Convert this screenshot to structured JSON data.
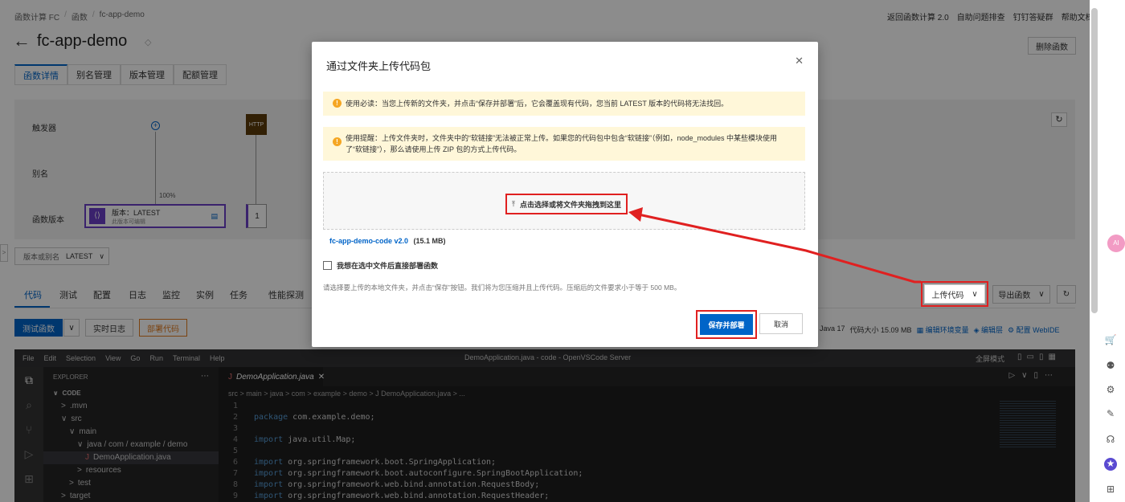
{
  "breadcrumb": {
    "items": [
      "函数计算 FC",
      "函数",
      "fc-app-demo"
    ]
  },
  "header_links": [
    "返回函数计算 2.0",
    "自助问题排查",
    "钉钉答疑群",
    "帮助文档"
  ],
  "page_title": "fc-app-demo",
  "delete_button": "删除函数",
  "main_tabs": [
    "函数详情",
    "别名管理",
    "版本管理",
    "配额管理"
  ],
  "flow": {
    "rows": [
      "触发器",
      "别名",
      "函数版本"
    ],
    "http_label": "HTTP",
    "percent": "100%",
    "version_title": "版本：LATEST",
    "version_sub": "此版本可编辑",
    "version_num": "1"
  },
  "version_select": {
    "label": "版本或别名",
    "value": "LATEST"
  },
  "sub_tabs": [
    "代码",
    "测试",
    "配置",
    "日志",
    "监控",
    "实例",
    "任务",
    "性能探测"
  ],
  "upload_code_button": "上传代码",
  "export_button": "导出函数",
  "test_button": "测试函数",
  "live_log_button": "实时日志",
  "deploy_button": "部署代码",
  "runtime_info": {
    "runtime": "Java 17",
    "size": "代码大小 15.09 MB",
    "env": "编辑环境变量",
    "layer": "编辑层",
    "webide": "配置 WebIDE"
  },
  "vscode": {
    "menu": [
      "File",
      "Edit",
      "Selection",
      "View",
      "Go",
      "Run",
      "Terminal",
      "Help"
    ],
    "title": "DemoApplication.java - code - OpenVSCode Server",
    "fullscreen": "全屏模式",
    "explorer_title": "EXPLORER",
    "tree": [
      {
        "label": "CODE",
        "indent": 0,
        "arrow": "∨"
      },
      {
        "label": ".mvn",
        "indent": 1,
        "arrow": ">"
      },
      {
        "label": "src",
        "indent": 1,
        "arrow": "∨"
      },
      {
        "label": "main",
        "indent": 2,
        "arrow": "∨"
      },
      {
        "label": "java / com / example / demo",
        "indent": 3,
        "arrow": "∨"
      },
      {
        "label": "DemoApplication.java",
        "indent": 4,
        "arrow": "J"
      },
      {
        "label": "resources",
        "indent": 3,
        "arrow": ">"
      },
      {
        "label": "test",
        "indent": 2,
        "arrow": ">"
      },
      {
        "label": "target",
        "indent": 1,
        "arrow": ">"
      }
    ],
    "tab_name": "DemoApplication.java",
    "path": "src > main > java > com > example > demo > J DemoApplication.java > ...",
    "code": [
      {
        "n": "1",
        "t": ""
      },
      {
        "n": "2",
        "t": "package com.example.demo;"
      },
      {
        "n": "3",
        "t": ""
      },
      {
        "n": "4",
        "t": "import java.util.Map;"
      },
      {
        "n": "5",
        "t": ""
      },
      {
        "n": "6",
        "t": "import org.springframework.boot.SpringApplication;"
      },
      {
        "n": "7",
        "t": "import org.springframework.boot.autoconfigure.SpringBootApplication;"
      },
      {
        "n": "8",
        "t": "import org.springframework.web.bind.annotation.RequestBody;"
      },
      {
        "n": "9",
        "t": "import org.springframework.web.bind.annotation.RequestHeader;"
      }
    ]
  },
  "modal": {
    "title": "通过文件夹上传代码包",
    "warning1": "使用必读：当您上传新的文件夹，并点击“保存并部署”后，它会覆盖现有代码，您当前 LATEST 版本的代码将无法找回。",
    "warning2": "使用提醒：上传文件夹时，文件夹中的“软链接”无法被正常上传。如果您的代码包中包含“软链接”（例如，node_modules 中某些模块使用了“软链接”），那么请使用上传 ZIP 包的方式上传代码。",
    "dropzone": "点击选择或将文件夹拖拽到这里",
    "file_name": "fc-app-demo-code v2.0",
    "file_size": "(15.1 MB)",
    "checkbox_label": "我想在选中文件后直接部署函数",
    "hint": "请选择要上传的本地文件夹，并点击“保存”按钮。我们将为您压缩并且上传代码。压缩后的文件要求小于等于 500 MB。",
    "save_button": "保存并部署",
    "cancel_button": "取消"
  },
  "colors": {
    "accent": "#0064c8",
    "highlight": "#e02020",
    "warn_bg": "#fff7d9",
    "overlay": "rgba(0,0,0,0.45)"
  }
}
